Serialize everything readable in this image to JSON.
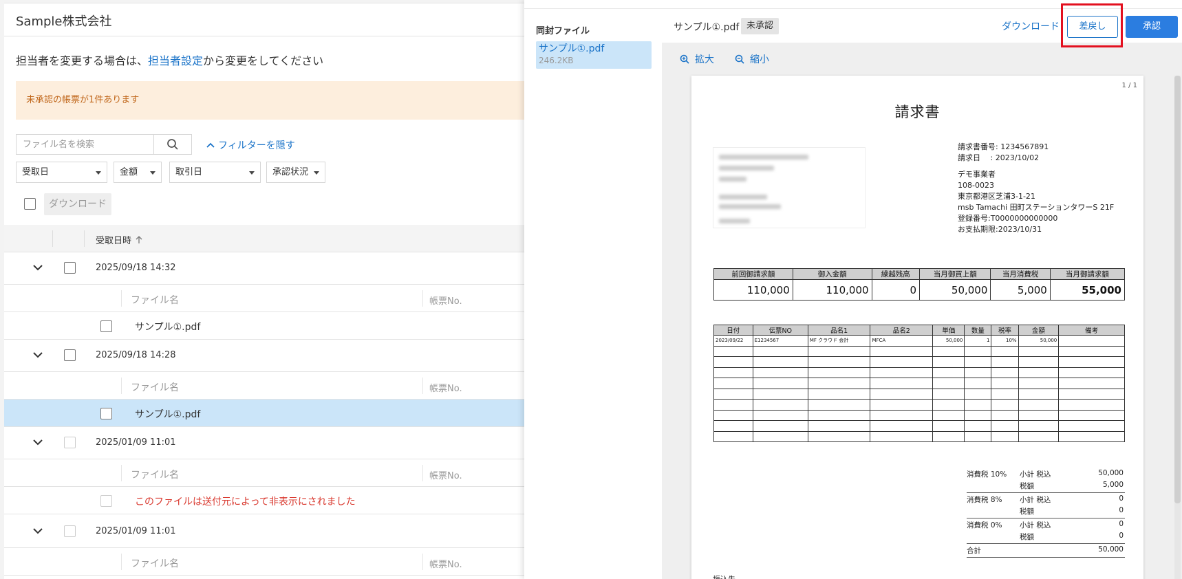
{
  "company": "Sample株式会社",
  "notice": {
    "prefix": "担当者を変更する場合は、",
    "link": "担当者設定",
    "suffix": "から変更をしてください"
  },
  "banner": "未承認の帳票が1件あります",
  "search": {
    "placeholder": "ファイル名を検索"
  },
  "filter_toggle": "フィルターを隠す",
  "filters": [
    "受取日",
    "金額",
    "取引日",
    "承認状況"
  ],
  "download_label": "ダウンロード",
  "table": {
    "header": "受取日時",
    "sub_headers": {
      "file_name": "ファイル名",
      "doc_no": "帳票No."
    },
    "groups": [
      {
        "datetime": "2025/09/18 14:32",
        "file": "サンプル①.pdf"
      },
      {
        "datetime": "2025/09/18 14:28",
        "file": "サンプル①.pdf"
      },
      {
        "datetime": "2025/01/09 11:01",
        "file": "このファイルは送付元によって非表示にされました"
      },
      {
        "datetime": "2025/01/09 11:01"
      }
    ]
  },
  "viewer": {
    "attach_title": "同封ファイル",
    "attach_name": "サンプル①.pdf",
    "attach_size": "246.2KB",
    "file_name": "サンプル①.pdf",
    "status_badge": "未承認",
    "download": "ダウンロード",
    "reject": "差戻し",
    "approve": "承認",
    "zoom_in": "拡大",
    "zoom_out": "縮小"
  },
  "invoice": {
    "page": "1 / 1",
    "title": "請求書",
    "number_label": "請求書番号:",
    "number": "1234567891",
    "date_label": "請求日　 :",
    "date": "2023/10/02",
    "issuer": "デモ事業者",
    "postal": "108-0023",
    "address1": "東京都港区芝浦3-1-21",
    "address2": "msb Tamachi 田町ステーションタワーS 21F",
    "reg_no": "登録番号:T0000000000000",
    "due": "お支払期限:2023/10/31",
    "summary_headers": [
      "前回御請求額",
      "御入金額",
      "繰越残高",
      "当月御買上額",
      "当月消費税",
      "当月御請求額"
    ],
    "summary_values": [
      "110,000",
      "110,000",
      "0",
      "50,000",
      "5,000",
      "55,000"
    ],
    "detail_headers": [
      "日付",
      "伝票NO",
      "品名1",
      "品名2",
      "単価",
      "数量",
      "税率",
      "金額",
      "備考"
    ],
    "detail_row": [
      "2023/09/22",
      "E1234567",
      "MF クラウド 会計",
      "MFCA",
      "50,000",
      "1",
      "10%",
      "50,000",
      ""
    ],
    "tax": {
      "t10": "消費税 10%",
      "t8": "消費税 8%",
      "t0": "消費税 0%",
      "subtotal": "小計 税込",
      "taxamt": "税額",
      "v10_sub": "50,000",
      "v10_tax": "5,000",
      "v8_sub": "0",
      "v8_tax": "0",
      "v0_sub": "0",
      "v0_tax": "0",
      "total_label": "合計",
      "total": "50,000"
    },
    "furikomi": "振込先"
  }
}
